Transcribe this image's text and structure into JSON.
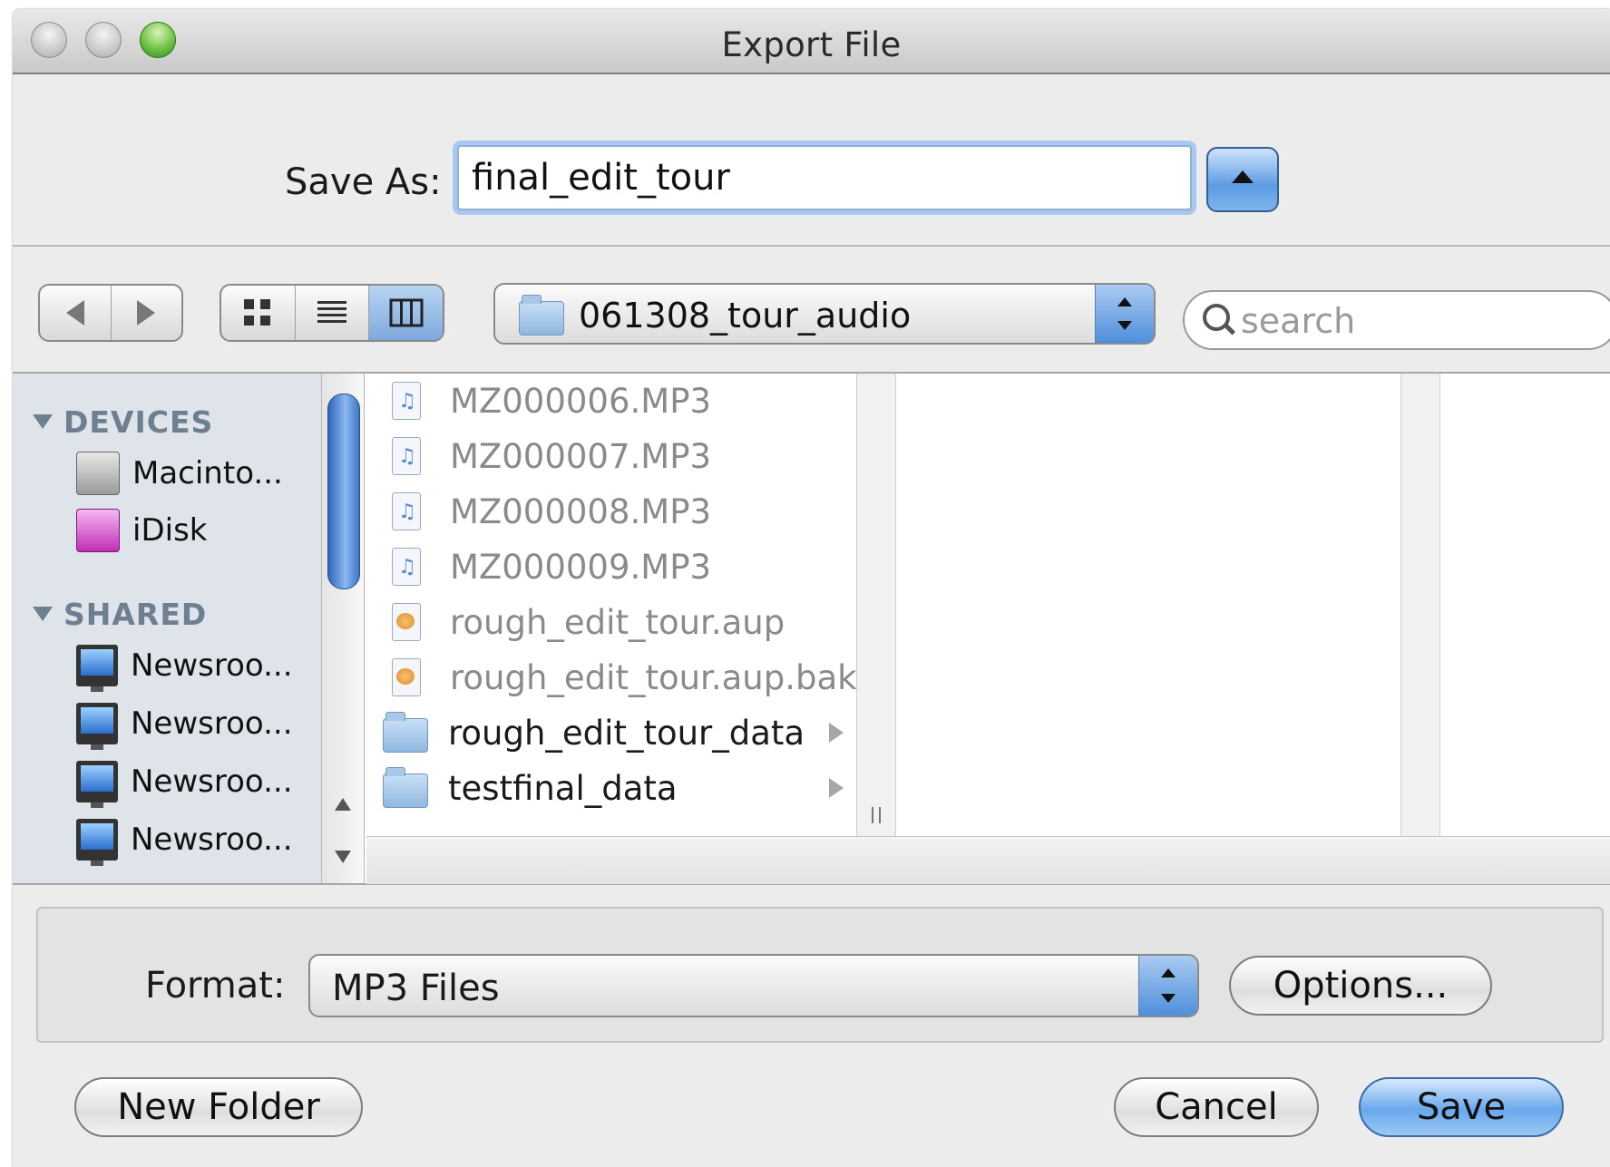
{
  "window": {
    "title": "Export File"
  },
  "save_as": {
    "label": "Save As:",
    "value": "final_edit_tour"
  },
  "toolbar": {
    "path_label": "061308_tour_audio",
    "search_placeholder": "search"
  },
  "sidebar": {
    "devices_header": "DEVICES",
    "devices": [
      {
        "label": "Macinto...",
        "icon": "hard-drive-icon"
      },
      {
        "label": "iDisk",
        "icon": "idisk-icon"
      }
    ],
    "shared_header": "SHARED",
    "shared": [
      {
        "label": "Newsroo...",
        "icon": "network-computer-icon"
      },
      {
        "label": "Newsroo...",
        "icon": "network-computer-icon"
      },
      {
        "label": "Newsroo...",
        "icon": "network-computer-icon"
      },
      {
        "label": "Newsroo...",
        "icon": "network-computer-icon"
      }
    ]
  },
  "files": [
    {
      "name": "MZ000006.MP3",
      "kind": "audio",
      "enabled": false
    },
    {
      "name": "MZ000007.MP3",
      "kind": "audio",
      "enabled": false
    },
    {
      "name": "MZ000008.MP3",
      "kind": "audio",
      "enabled": false
    },
    {
      "name": "MZ000009.MP3",
      "kind": "audio",
      "enabled": false
    },
    {
      "name": "rough_edit_tour.aup",
      "kind": "project",
      "enabled": false
    },
    {
      "name": "rough_edit_tour.aup.bak",
      "kind": "project",
      "enabled": false
    },
    {
      "name": "rough_edit_tour_data",
      "kind": "folder",
      "enabled": true
    },
    {
      "name": "testfinal_data",
      "kind": "folder",
      "enabled": true
    }
  ],
  "format": {
    "label": "Format:",
    "value": "MP3 Files",
    "options_label": "Options..."
  },
  "buttons": {
    "new_folder": "New Folder",
    "cancel": "Cancel",
    "save": "Save"
  }
}
